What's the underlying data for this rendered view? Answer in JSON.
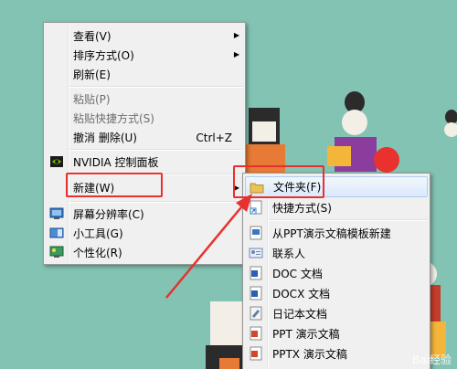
{
  "context_menu": {
    "items": [
      {
        "label": "查看(V)",
        "has_submenu": true
      },
      {
        "label": "排序方式(O)",
        "has_submenu": true
      },
      {
        "label": "刷新(E)"
      },
      {
        "label": "粘贴(P)",
        "disabled": true
      },
      {
        "label": "粘贴快捷方式(S)",
        "disabled": true
      },
      {
        "label": "撤消 删除(U)",
        "shortcut": "Ctrl+Z"
      },
      {
        "label": "NVIDIA 控制面板",
        "icon": "nvidia-icon"
      },
      {
        "label": "新建(W)",
        "has_submenu": true
      },
      {
        "label": "屏幕分辨率(C)",
        "icon": "monitor-icon"
      },
      {
        "label": "小工具(G)",
        "icon": "gadgets-icon"
      },
      {
        "label": "个性化(R)",
        "icon": "personalize-icon"
      }
    ]
  },
  "new_submenu": {
    "items": [
      {
        "label": "文件夹(F)",
        "icon": "folder-icon"
      },
      {
        "label": "快捷方式(S)",
        "icon": "shortcut-icon"
      },
      {
        "label": "从PPT演示文稿模板新建",
        "icon": "ppt-template-icon"
      },
      {
        "label": "联系人",
        "icon": "contact-icon"
      },
      {
        "label": "DOC 文档",
        "icon": "doc-icon"
      },
      {
        "label": "DOCX 文档",
        "icon": "docx-icon"
      },
      {
        "label": "日记本文档",
        "icon": "journal-icon"
      },
      {
        "label": "PPT 演示文稿",
        "icon": "ppt-icon"
      },
      {
        "label": "PPTX 演示文稿",
        "icon": "pptx-icon"
      }
    ]
  },
  "watermark": "Bai经验",
  "colors": {
    "annotation": "#e8302e",
    "desktop": "#83c3b3"
  }
}
